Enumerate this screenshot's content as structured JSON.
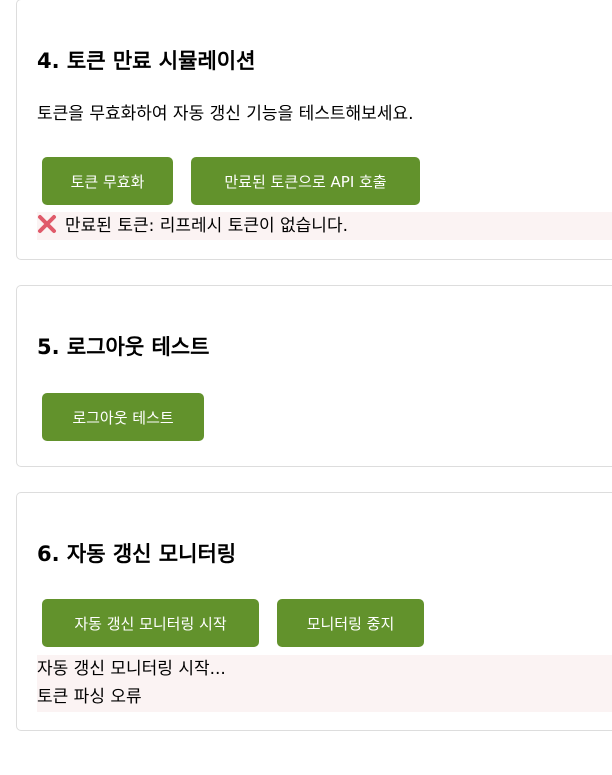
{
  "section4": {
    "title": "4. 토큰 만료 시뮬레이션",
    "description": "토큰을 무효화하여 자동 갱신 기능을 테스트해보세요.",
    "buttons": {
      "invalidate": "토큰 무효화",
      "call_api": "만료된 토큰으로 API 호출"
    },
    "result": {
      "icon": "cross-mark-icon",
      "text": "만료된 토큰: 리프레시 토큰이 없습니다."
    }
  },
  "section5": {
    "title": "5. 로그아웃 테스트",
    "buttons": {
      "logout": "로그아웃 테스트"
    }
  },
  "section6": {
    "title": "6. 자동 갱신 모니터링",
    "buttons": {
      "start": "자동 갱신 모니터링 시작",
      "stop": "모니터링 중지"
    },
    "log": [
      "자동 갱신 모니터링 시작...",
      "토큰 파싱 오류"
    ]
  },
  "colors": {
    "button_bg": "#62922c",
    "button_text": "#ffffff",
    "result_bg": "#fbf3f3",
    "border": "#dddddd",
    "cross_icon": "#e05a6a"
  }
}
